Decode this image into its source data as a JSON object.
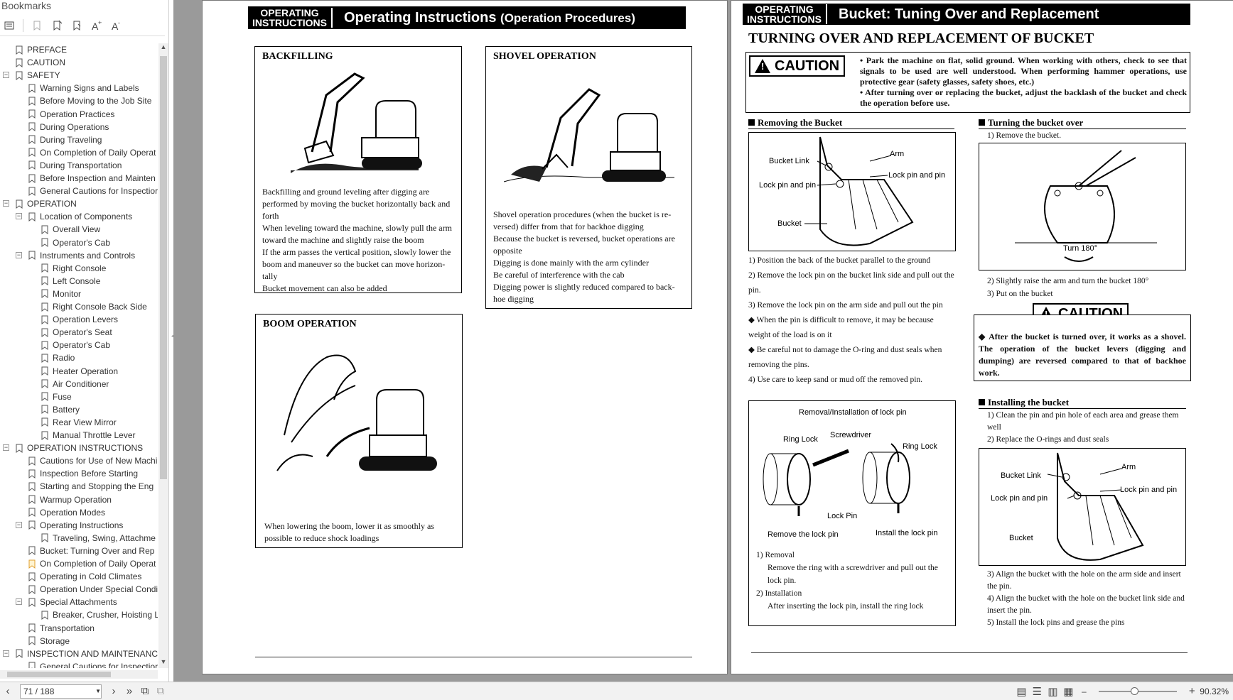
{
  "sidebar": {
    "title": "Bookmarks",
    "items": [
      {
        "label": "PREFACE",
        "level": 0
      },
      {
        "label": "CAUTION",
        "level": 0
      },
      {
        "label": "SAFETY",
        "level": 0,
        "expanded": true
      },
      {
        "label": "Warning Signs and Labels",
        "level": 1
      },
      {
        "label": "Before Moving to the Job Site",
        "level": 1
      },
      {
        "label": "Operation Practices",
        "level": 1
      },
      {
        "label": "During Operations",
        "level": 1
      },
      {
        "label": "During Traveling",
        "level": 1
      },
      {
        "label": "On Completion of Daily Operat",
        "level": 1
      },
      {
        "label": "During Transportation",
        "level": 1
      },
      {
        "label": "Before Inspection and Mainten",
        "level": 1
      },
      {
        "label": "General Cautions for Inspectior",
        "level": 1
      },
      {
        "label": "OPERATION",
        "level": 0,
        "expanded": true
      },
      {
        "label": "Location of Components",
        "level": 1,
        "expanded": true
      },
      {
        "label": "Overall View",
        "level": 2
      },
      {
        "label": "Operator's Cab",
        "level": 2
      },
      {
        "label": "Instruments and Controls",
        "level": 1,
        "expanded": true
      },
      {
        "label": "Right Console",
        "level": 2
      },
      {
        "label": "Left Console",
        "level": 2
      },
      {
        "label": "Monitor",
        "level": 2
      },
      {
        "label": "Right Console Back Side",
        "level": 2
      },
      {
        "label": "Operation Levers",
        "level": 2
      },
      {
        "label": "Operator's Seat",
        "level": 2
      },
      {
        "label": "Operator's Cab",
        "level": 2
      },
      {
        "label": "Radio",
        "level": 2
      },
      {
        "label": "Heater Operation",
        "level": 2
      },
      {
        "label": "Air Conditioner",
        "level": 2
      },
      {
        "label": "Fuse",
        "level": 2
      },
      {
        "label": "Battery",
        "level": 2
      },
      {
        "label": "Rear View Mirror",
        "level": 2
      },
      {
        "label": "Manual Throttle Lever",
        "level": 2
      },
      {
        "label": "OPERATION INSTRUCTIONS",
        "level": 0,
        "expanded": true
      },
      {
        "label": "Cautions for Use of New Machi",
        "level": 1
      },
      {
        "label": "Inspection Before Starting",
        "level": 1
      },
      {
        "label": "Starting and Stopping the Eng",
        "level": 1
      },
      {
        "label": "Warmup Operation",
        "level": 1
      },
      {
        "label": "Operation Modes",
        "level": 1
      },
      {
        "label": "Operating Instructions",
        "level": 1,
        "expanded": true
      },
      {
        "label": "Traveling, Swing, Attachme",
        "level": 2
      },
      {
        "label": "Bucket: Turning Over and Rep",
        "level": 1
      },
      {
        "label": "On Completion of Daily Operat",
        "level": 1,
        "highlight": true
      },
      {
        "label": "Operating in Cold Climates",
        "level": 1
      },
      {
        "label": "Operation Under Special Condi",
        "level": 1
      },
      {
        "label": "Special Attachments",
        "level": 1,
        "expanded": true
      },
      {
        "label": "Breaker, Crusher, Hoisting L",
        "level": 2
      },
      {
        "label": "Transportation",
        "level": 1
      },
      {
        "label": "Storage",
        "level": 1
      },
      {
        "label": "INSPECTION AND MAINTENANCE",
        "level": 0,
        "expanded": true
      },
      {
        "label": "General Cautions for Inspectior",
        "level": 1
      }
    ]
  },
  "left_page": {
    "banner_small": "OPERATING\nINSTRUCTIONS",
    "banner_title": "Operating Instructions",
    "banner_sub": "(Operation Procedures)",
    "backfilling": {
      "title": "BACKFILLING",
      "paras": [
        "Backfilling and ground leveling after digging are performed by moving the bucket horizontally back and forth",
        "When leveling toward the machine, slowly pull the arm toward the machine and slightly raise the boom",
        "If the arm passes the vertical position, slowly lower the boom and maneuver so the bucket can move horizon-tally",
        "Bucket movement can also be added"
      ]
    },
    "shovel": {
      "title": "SHOVEL OPERATION",
      "paras": [
        "Shovel operation procedures (when the bucket is re-versed) differ from that for backhoe digging",
        "Because the bucket is reversed, bucket operations are opposite",
        "Digging is done mainly with the arm cylinder",
        "Be careful of interference with the cab",
        "Digging power is slightly reduced compared to back-hoe digging"
      ]
    },
    "boom": {
      "title": "BOOM OPERATION",
      "paras": [
        "When lowering the boom, lower it as smoothly as possible to reduce shock loadings"
      ]
    }
  },
  "right_page": {
    "banner_small": "OPERATING\nINSTRUCTIONS",
    "banner_title": "Bucket: Tuning Over and Replacement",
    "heading": "TURNING OVER AND REPLACEMENT OF BUCKET",
    "caution_label": "CAUTION",
    "caution_points": [
      "Park the machine on flat, solid ground. When working with others, check to see that signals to be used are well understood. When performing hammer operations, use protective gear (safety glasses, safety shoes, etc.)",
      "After turning over or replacing the bucket, adjust the backlash of the bucket and check the operation before use."
    ],
    "removing": {
      "title": "Removing the Bucket",
      "labels": {
        "link": "Bucket Link",
        "arm": "Arm",
        "lockpin": "Lock pin and pin",
        "lockpin2": "Lock pin and pin",
        "bucket": "Bucket"
      },
      "steps": [
        "1)  Position the back of the bucket parallel to the ground",
        "2)  Remove the lock pin on the bucket link side and pull out the pin.",
        "3)  Remove the lock pin on the arm side and pull out the pin"
      ],
      "notes": [
        "When the pin is difficult to remove, it may be because weight of the load is on it",
        "Be careful not to damage the O-ring and dust seals when removing the pins."
      ],
      "step4": "4)  Use care to keep sand or mud off the removed pin."
    },
    "lockpin": {
      "title": "Removal/Installation of lock pin",
      "ring1": "Ring Lock",
      "screwdriver": "Screwdriver",
      "ring2": "Ring Lock",
      "lock": "Lock Pin",
      "remove": "Remove the lock pin",
      "install": "Install the lock pin",
      "steps": [
        "1)  Removal",
        "Remove the ring with a screwdriver and pull out the lock pin.",
        "2)  Installation",
        "After inserting the lock pin, install the ring lock"
      ]
    },
    "turning": {
      "title": "Turning the bucket over",
      "step1": "1)  Remove the bucket.",
      "turn_label": "Turn 180°",
      "steps": [
        "2)  Slightly raise the arm and turn the bucket 180°",
        "3)  Put on the bucket"
      ]
    },
    "caution2": {
      "label": "CAUTION",
      "text": "After the bucket is turned over, it works as a shovel. The operation of the bucket levers (digging and dumping) are reversed compared to that of backhoe work."
    },
    "installing": {
      "title": "Installing the bucket",
      "steps_top": [
        "1)  Clean the pin and pin hole of each area and grease them well",
        "2)  Replace the O-rings and dust seals"
      ],
      "labels": {
        "link": "Bucket Link",
        "arm": "Arm",
        "lockpin": "Lock pin and pin",
        "lockpin2": "Lock pin and pin",
        "bucket": "Bucket"
      },
      "steps": [
        "3)  Align the bucket with the hole on the arm side and insert the pin.",
        "4)  Align the bucket with the hole on the bucket link side and insert the pin.",
        "5)  Install the lock pins and grease the pins"
      ]
    }
  },
  "statusbar": {
    "page": "71 / 188",
    "zoom": "90.32%",
    "zoom_fraction": 0.45
  }
}
